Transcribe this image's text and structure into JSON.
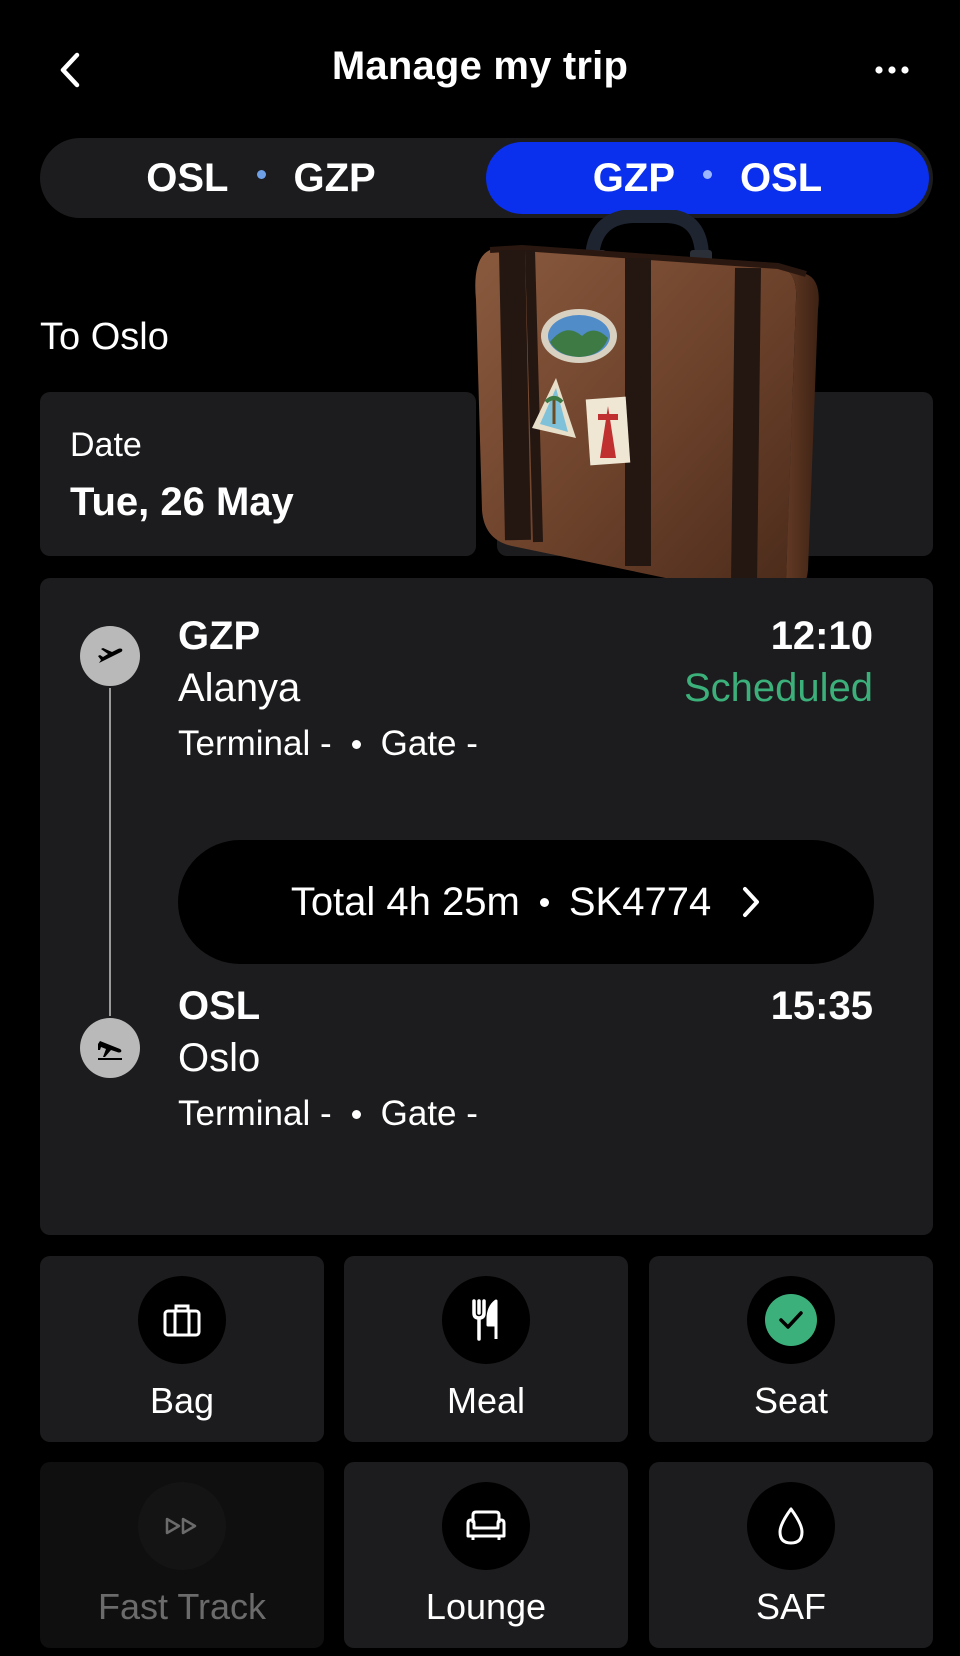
{
  "header": {
    "title": "Manage my trip"
  },
  "segments": [
    {
      "from": "OSL",
      "to": "GZP",
      "selected": false
    },
    {
      "from": "GZP",
      "to": "OSL",
      "selected": true
    }
  ],
  "subtitle": "To Oslo",
  "date": {
    "label": "Date",
    "value": "Tue, 26 May"
  },
  "flight": {
    "departure": {
      "code": "GZP",
      "city": "Alanya",
      "time": "12:10",
      "status": "Scheduled",
      "terminal": "Terminal -",
      "gate": "Gate -"
    },
    "summary": {
      "total": "Total 4h 25m",
      "flight_number": "SK4774"
    },
    "arrival": {
      "code": "OSL",
      "city": "Oslo",
      "time": "15:35",
      "terminal": "Terminal -",
      "gate": "Gate -"
    }
  },
  "services": [
    {
      "label": "Bag",
      "icon": "briefcase-icon",
      "enabled": true
    },
    {
      "label": "Meal",
      "icon": "cutlery-icon",
      "enabled": true
    },
    {
      "label": "Seat",
      "icon": "check-icon",
      "enabled": true,
      "done": true
    },
    {
      "label": "Fast Track",
      "icon": "fast-forward-icon",
      "enabled": false
    },
    {
      "label": "Lounge",
      "icon": "sofa-icon",
      "enabled": true
    },
    {
      "label": "SAF",
      "icon": "drop-icon",
      "enabled": true
    }
  ],
  "colors": {
    "accent": "#0a30ee",
    "status_green": "#3cb07a",
    "card": "#1c1c1e",
    "background": "#000000"
  }
}
